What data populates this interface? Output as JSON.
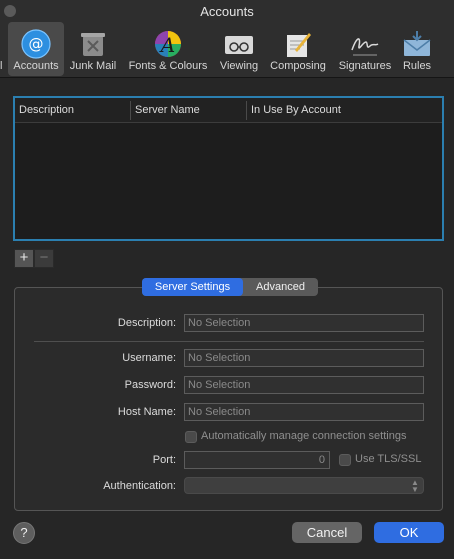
{
  "window": {
    "title": "Accounts"
  },
  "toolbar": {
    "partial_label": "l",
    "items": [
      {
        "label": "Accounts",
        "icon": "at-sign-icon",
        "selected": true
      },
      {
        "label": "Junk Mail",
        "icon": "junk-bin-icon",
        "selected": false
      },
      {
        "label": "Fonts & Colours",
        "icon": "font-colour-icon",
        "selected": false
      },
      {
        "label": "Viewing",
        "icon": "glasses-icon",
        "selected": false
      },
      {
        "label": "Composing",
        "icon": "pencil-notepad-icon",
        "selected": false
      },
      {
        "label": "Signatures",
        "icon": "signature-icon",
        "selected": false
      },
      {
        "label": "Rules",
        "icon": "rules-envelope-icon",
        "selected": false
      }
    ]
  },
  "accounts_table": {
    "columns": [
      "Description",
      "Server Name",
      "In Use By Account"
    ],
    "rows": []
  },
  "list_controls": {
    "add_label": "+",
    "remove_label": "−"
  },
  "tabs": {
    "server_settings": "Server Settings",
    "advanced": "Advanced",
    "selected": "Server Settings"
  },
  "form": {
    "description": {
      "label": "Description:",
      "value": "No Selection"
    },
    "username": {
      "label": "Username:",
      "value": "No Selection"
    },
    "password": {
      "label": "Password:",
      "value": "No Selection"
    },
    "host_name": {
      "label": "Host Name:",
      "value": "No Selection"
    },
    "auto_manage": {
      "label": "Automatically manage connection settings",
      "checked": false
    },
    "port": {
      "label": "Port:",
      "value": "0"
    },
    "tls": {
      "label": "Use TLS/SSL",
      "checked": false
    },
    "authentication": {
      "label": "Authentication:",
      "value": ""
    }
  },
  "footer": {
    "help_label": "?",
    "cancel_label": "Cancel",
    "ok_label": "OK"
  },
  "colors": {
    "accent": "#2f6de1",
    "list_focus": "#2b7fb0",
    "window_bg": "#262626"
  }
}
